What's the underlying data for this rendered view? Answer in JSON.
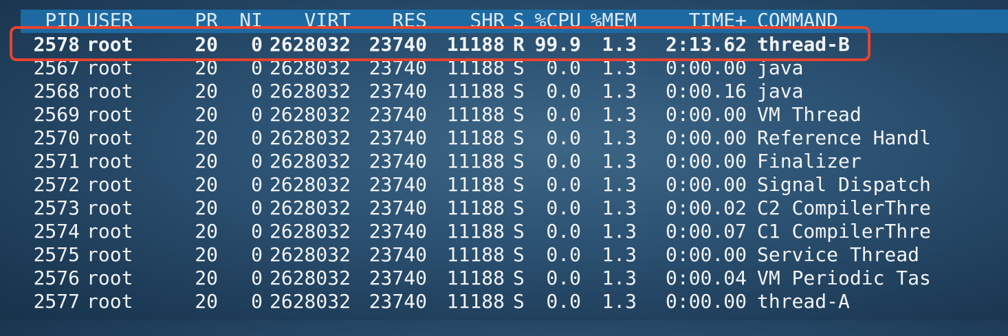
{
  "columns": {
    "pid": "PID",
    "user": "USER",
    "pr": "PR",
    "ni": "NI",
    "virt": "VIRT",
    "res": "RES",
    "shr": "SHR",
    "s": "S",
    "cpu": "%CPU",
    "mem": "%MEM",
    "time": "TIME+",
    "command": "COMMAND"
  },
  "rows": [
    {
      "pid": "2578",
      "user": "root",
      "pr": "20",
      "ni": "0",
      "virt": "2628032",
      "res": "23740",
      "shr": "11188",
      "s": "R",
      "cpu": "99.9",
      "mem": "1.3",
      "time": "2:13.62",
      "command": "thread-B"
    },
    {
      "pid": "2567",
      "user": "root",
      "pr": "20",
      "ni": "0",
      "virt": "2628032",
      "res": "23740",
      "shr": "11188",
      "s": "S",
      "cpu": "0.0",
      "mem": "1.3",
      "time": "0:00.00",
      "command": "java"
    },
    {
      "pid": "2568",
      "user": "root",
      "pr": "20",
      "ni": "0",
      "virt": "2628032",
      "res": "23740",
      "shr": "11188",
      "s": "S",
      "cpu": "0.0",
      "mem": "1.3",
      "time": "0:00.16",
      "command": "java"
    },
    {
      "pid": "2569",
      "user": "root",
      "pr": "20",
      "ni": "0",
      "virt": "2628032",
      "res": "23740",
      "shr": "11188",
      "s": "S",
      "cpu": "0.0",
      "mem": "1.3",
      "time": "0:00.00",
      "command": "VM Thread"
    },
    {
      "pid": "2570",
      "user": "root",
      "pr": "20",
      "ni": "0",
      "virt": "2628032",
      "res": "23740",
      "shr": "11188",
      "s": "S",
      "cpu": "0.0",
      "mem": "1.3",
      "time": "0:00.00",
      "command": "Reference Handl"
    },
    {
      "pid": "2571",
      "user": "root",
      "pr": "20",
      "ni": "0",
      "virt": "2628032",
      "res": "23740",
      "shr": "11188",
      "s": "S",
      "cpu": "0.0",
      "mem": "1.3",
      "time": "0:00.00",
      "command": "Finalizer"
    },
    {
      "pid": "2572",
      "user": "root",
      "pr": "20",
      "ni": "0",
      "virt": "2628032",
      "res": "23740",
      "shr": "11188",
      "s": "S",
      "cpu": "0.0",
      "mem": "1.3",
      "time": "0:00.00",
      "command": "Signal Dispatch"
    },
    {
      "pid": "2573",
      "user": "root",
      "pr": "20",
      "ni": "0",
      "virt": "2628032",
      "res": "23740",
      "shr": "11188",
      "s": "S",
      "cpu": "0.0",
      "mem": "1.3",
      "time": "0:00.02",
      "command": "C2 CompilerThre"
    },
    {
      "pid": "2574",
      "user": "root",
      "pr": "20",
      "ni": "0",
      "virt": "2628032",
      "res": "23740",
      "shr": "11188",
      "s": "S",
      "cpu": "0.0",
      "mem": "1.3",
      "time": "0:00.07",
      "command": "C1 CompilerThre"
    },
    {
      "pid": "2575",
      "user": "root",
      "pr": "20",
      "ni": "0",
      "virt": "2628032",
      "res": "23740",
      "shr": "11188",
      "s": "S",
      "cpu": "0.0",
      "mem": "1.3",
      "time": "0:00.00",
      "command": "Service Thread"
    },
    {
      "pid": "2576",
      "user": "root",
      "pr": "20",
      "ni": "0",
      "virt": "2628032",
      "res": "23740",
      "shr": "11188",
      "s": "S",
      "cpu": "0.0",
      "mem": "1.3",
      "time": "0:00.04",
      "command": "VM Periodic Tas"
    },
    {
      "pid": "2577",
      "user": "root",
      "pr": "20",
      "ni": "0",
      "virt": "2628032",
      "res": "23740",
      "shr": "11188",
      "s": "S",
      "cpu": "0.0",
      "mem": "1.3",
      "time": "0:00.00",
      "command": "thread-A"
    }
  ],
  "colors": {
    "header_bar": "#1d6aa3",
    "highlight_border": "#e8432f",
    "text": "#f2f4f6"
  }
}
